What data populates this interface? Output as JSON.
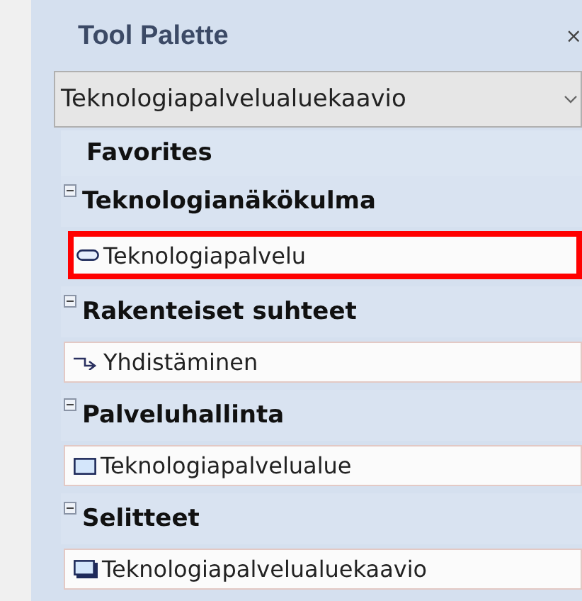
{
  "palette": {
    "title": "Tool Palette",
    "close": "×",
    "dropdown": {
      "value": "Teknologiapalvelualuekaavio"
    },
    "favorites": "Favorites",
    "sections": [
      {
        "title": "Teknologianäkökulma",
        "expanded": true,
        "items": [
          {
            "label": "Teknologiapalvelu",
            "kind": "pill",
            "highlighted": true
          }
        ]
      },
      {
        "title": "Rakenteiset suhteet",
        "expanded": true,
        "items": [
          {
            "label": "Yhdistäminen",
            "kind": "arrow",
            "highlighted": false
          }
        ]
      },
      {
        "title": "Palveluhallinta",
        "expanded": true,
        "items": [
          {
            "label": "Teknologiapalvelualue",
            "kind": "rect",
            "highlighted": false
          }
        ]
      },
      {
        "title": "Selitteet",
        "expanded": true,
        "items": [
          {
            "label": "Teknologiapalvelualuekaavio",
            "kind": "shadowrect",
            "highlighted": false
          }
        ]
      }
    ]
  }
}
